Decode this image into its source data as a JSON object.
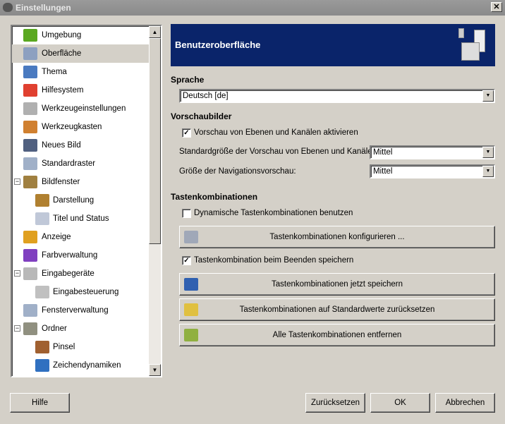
{
  "window": {
    "title": "Einstellungen",
    "close": "✕"
  },
  "sidebar": {
    "items": [
      {
        "label": "Umgebung",
        "level": 0,
        "color": "#5aa820"
      },
      {
        "label": "Oberfläche",
        "level": 0,
        "color": "#8da0c0",
        "selected": true
      },
      {
        "label": "Thema",
        "level": 0,
        "color": "#4a7ac0"
      },
      {
        "label": "Hilfesystem",
        "level": 0,
        "color": "#e04030"
      },
      {
        "label": "Werkzeugeinstellungen",
        "level": 0,
        "color": "#b0b0b0"
      },
      {
        "label": "Werkzeugkasten",
        "level": 0,
        "color": "#d08030"
      },
      {
        "label": "Neues Bild",
        "level": 0,
        "color": "#506080"
      },
      {
        "label": "Standardraster",
        "level": 0,
        "color": "#a0b0c8"
      },
      {
        "label": "Bildfenster",
        "level": 0,
        "color": "#a08040",
        "expander": "−"
      },
      {
        "label": "Darstellung",
        "level": 1,
        "color": "#b08030"
      },
      {
        "label": "Titel und Status",
        "level": 1,
        "color": "#c0c8d8"
      },
      {
        "label": "Anzeige",
        "level": 0,
        "color": "#e0a020"
      },
      {
        "label": "Farbverwaltung",
        "level": 0,
        "color": "#8040c0"
      },
      {
        "label": "Eingabegeräte",
        "level": 0,
        "color": "#b8b8b8",
        "expander": "−"
      },
      {
        "label": "Eingabesteuerung",
        "level": 1,
        "color": "#c0c0c0"
      },
      {
        "label": "Fensterverwaltung",
        "level": 0,
        "color": "#a0b0c8"
      },
      {
        "label": "Ordner",
        "level": 0,
        "color": "#909080",
        "expander": "−"
      },
      {
        "label": "Pinsel",
        "level": 1,
        "color": "#a06030"
      },
      {
        "label": "Zeichendynamiken",
        "level": 1,
        "color": "#3070c0"
      }
    ]
  },
  "header": {
    "title": "Benutzeroberfläche"
  },
  "language": {
    "heading": "Sprache",
    "value": "Deutsch [de]"
  },
  "previews": {
    "heading": "Vorschaubilder",
    "enable": {
      "label": "Vorschau von Ebenen und Kanälen aktivieren",
      "checked": true
    },
    "default_size": {
      "label": "Standardgröße der Vorschau von Ebenen und Kanälen:",
      "value": "Mittel"
    },
    "nav_size": {
      "label": "Größe der Navigationsvorschau:",
      "value": "Mittel"
    }
  },
  "shortcuts": {
    "heading": "Tastenkombinationen",
    "dynamic": {
      "label": "Dynamische Tastenkombinationen benutzen",
      "checked": false
    },
    "configure": "Tastenkombinationen konfigurieren ...",
    "save_on_exit": {
      "label": "Tastenkombination beim Beenden speichern",
      "checked": true
    },
    "save_now": "Tastenkombinationen jetzt speichern",
    "reset": "Tastenkombinationen auf Standardwerte zurücksetzen",
    "remove_all": "Alle Tastenkombinationen entfernen"
  },
  "footer": {
    "help": "Hilfe",
    "reset": "Zurücksetzen",
    "ok": "OK",
    "cancel": "Abbrechen"
  }
}
